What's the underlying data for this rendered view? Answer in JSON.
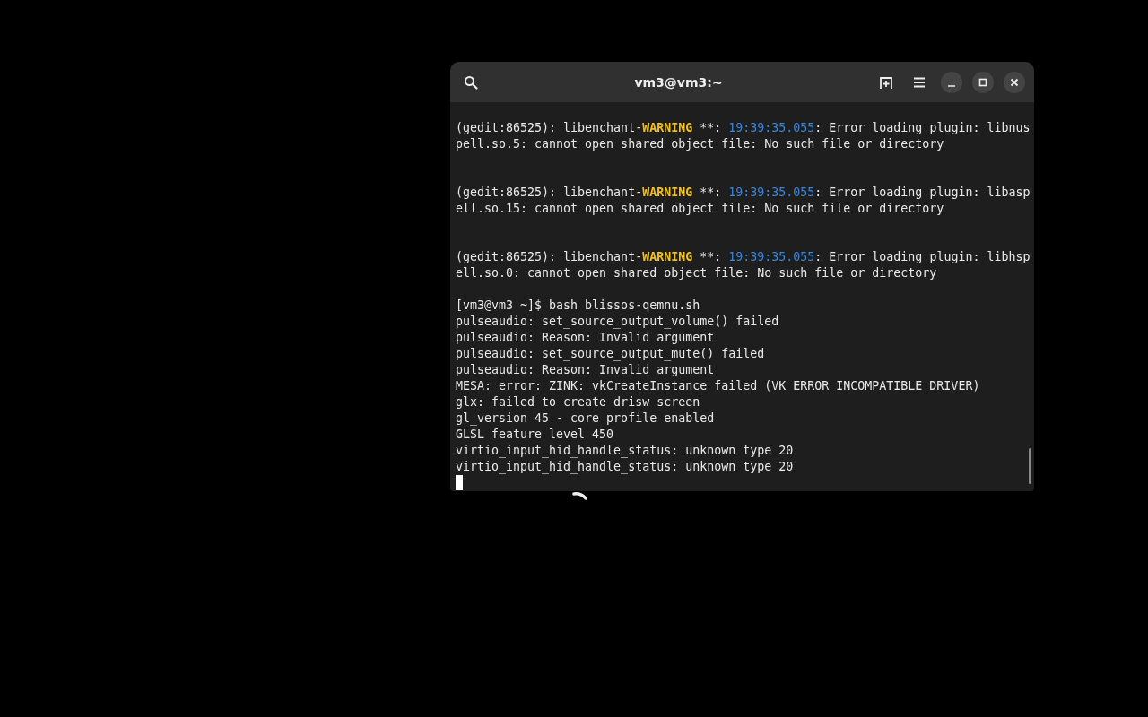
{
  "window": {
    "title": "vm3@vm3:~"
  },
  "lines": [
    {
      "kind": "segments",
      "parts": [
        {
          "kind": "plain",
          "text": "(gedit:86525): libenchant-"
        },
        {
          "kind": "warning",
          "text": "WARNING"
        },
        {
          "kind": "plain",
          "text": " **: "
        },
        {
          "kind": "time",
          "text": "19:39:35.055"
        },
        {
          "kind": "plain",
          "text": ": Error loading plugin: libnus"
        }
      ]
    },
    {
      "kind": "text",
      "text": "pell.so.5: cannot open shared object file: No such file or directory"
    },
    {
      "kind": "blank"
    },
    {
      "kind": "blank"
    },
    {
      "kind": "segments",
      "parts": [
        {
          "kind": "plain",
          "text": "(gedit:86525): libenchant-"
        },
        {
          "kind": "warning",
          "text": "WARNING"
        },
        {
          "kind": "plain",
          "text": " **: "
        },
        {
          "kind": "time",
          "text": "19:39:35.055"
        },
        {
          "kind": "plain",
          "text": ": Error loading plugin: libasp"
        }
      ]
    },
    {
      "kind": "text",
      "text": "ell.so.15: cannot open shared object file: No such file or directory"
    },
    {
      "kind": "blank"
    },
    {
      "kind": "blank"
    },
    {
      "kind": "segments",
      "parts": [
        {
          "kind": "plain",
          "text": "(gedit:86525): libenchant-"
        },
        {
          "kind": "warning",
          "text": "WARNING"
        },
        {
          "kind": "plain",
          "text": " **: "
        },
        {
          "kind": "time",
          "text": "19:39:35.055"
        },
        {
          "kind": "plain",
          "text": ": Error loading plugin: libhsp"
        }
      ]
    },
    {
      "kind": "text",
      "text": "ell.so.0: cannot open shared object file: No such file or directory"
    },
    {
      "kind": "blank"
    },
    {
      "kind": "text",
      "text": "[vm3@vm3 ~]$ bash blissos-qemnu.sh"
    },
    {
      "kind": "text",
      "text": "pulseaudio: set_source_output_volume() failed"
    },
    {
      "kind": "text",
      "text": "pulseaudio: Reason: Invalid argument"
    },
    {
      "kind": "text",
      "text": "pulseaudio: set_source_output_mute() failed"
    },
    {
      "kind": "text",
      "text": "pulseaudio: Reason: Invalid argument"
    },
    {
      "kind": "text",
      "text": "MESA: error: ZINK: vkCreateInstance failed (VK_ERROR_INCOMPATIBLE_DRIVER)"
    },
    {
      "kind": "text",
      "text": "glx: failed to create drisw screen"
    },
    {
      "kind": "text",
      "text": "gl_version 45 - core profile enabled"
    },
    {
      "kind": "text",
      "text": "GLSL feature level 450"
    },
    {
      "kind": "text",
      "text": "virtio_input_hid_handle_status: unknown type 20"
    },
    {
      "kind": "text",
      "text": "virtio_input_hid_handle_status: unknown type 20"
    },
    {
      "kind": "cursor"
    }
  ]
}
